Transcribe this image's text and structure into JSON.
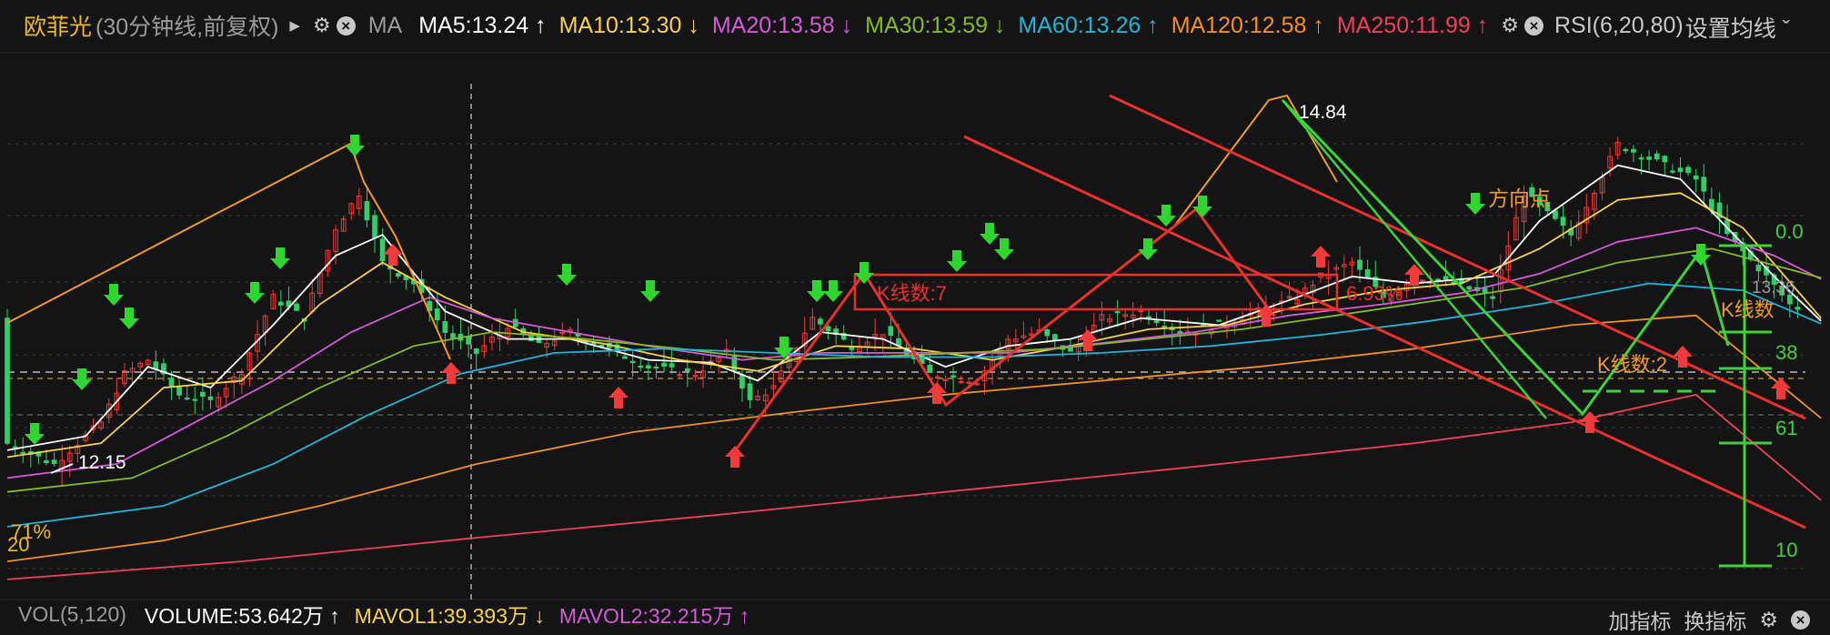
{
  "header": {
    "stock_name": "欧菲光",
    "period": "(30分钟线,前复权)",
    "ma_label": "MA",
    "ma_items": [
      {
        "name": "MA5",
        "value": "13.24",
        "dir": "↑",
        "color": "#ffffff"
      },
      {
        "name": "MA10",
        "value": "13.30",
        "dir": "↓",
        "color": "#f7d24b"
      },
      {
        "name": "MA20",
        "value": "13.58",
        "dir": "↓",
        "color": "#d45ad8"
      },
      {
        "name": "MA30",
        "value": "13.59",
        "dir": "↓",
        "color": "#86b924"
      },
      {
        "name": "MA60",
        "value": "13.26",
        "dir": "↑",
        "color": "#1eb6d6"
      },
      {
        "name": "MA120",
        "value": "12.58",
        "dir": "↑",
        "color": "#f28f25"
      },
      {
        "name": "MA250",
        "value": "11.99",
        "dir": "↑",
        "color": "#f03e5f"
      }
    ],
    "rsi_label": "RSI(6,20,80)",
    "set_ma_label": "设置均线 ˇ"
  },
  "annotations": {
    "high_label": "14.84",
    "low_label": "12.15",
    "direction_point": "方向点",
    "kline_count_1": "K线数:7",
    "kline_count_2": "K线数:2",
    "kline_count_3": "K线数",
    "pct_label": "6.93%",
    "fib_0": "0.0",
    "fib_38": "38",
    "fib_61": "61",
    "fib_100": "10",
    "left_pct": "71%",
    "left_val": "20",
    "right_price": "13.36"
  },
  "volume_bar": {
    "vol_label": "VOL(5,120)",
    "volume_text": "VOLUME:53.642万 ↑",
    "mavol1_text": "MAVOL1:39.393万 ↓",
    "mavol2_text": "MAVOL2:32.215万 ↑",
    "volume_color": "#ffffff",
    "mavol1_color": "#f7d24b",
    "mavol2_color": "#d45ad8",
    "add_indicator": "加指标",
    "switch_indicator": "换指标"
  },
  "chart_data": {
    "type": "line",
    "title": "",
    "x_count": 230,
    "ylim": [
      11.4,
      15.0
    ],
    "price_path": [
      [
        0,
        12.4
      ],
      [
        6,
        12.25
      ],
      [
        12,
        12.55
      ],
      [
        15,
        12.9
      ],
      [
        18,
        13.0
      ],
      [
        22,
        12.75
      ],
      [
        26,
        12.7
      ],
      [
        30,
        12.92
      ],
      [
        34,
        13.45
      ],
      [
        38,
        13.3
      ],
      [
        42,
        13.95
      ],
      [
        45,
        14.2
      ],
      [
        48,
        13.7
      ],
      [
        52,
        13.55
      ],
      [
        56,
        13.2
      ],
      [
        60,
        13.05
      ],
      [
        64,
        13.25
      ],
      [
        68,
        13.1
      ],
      [
        72,
        13.2
      ],
      [
        76,
        13.1
      ],
      [
        82,
        12.95
      ],
      [
        88,
        12.9
      ],
      [
        92,
        13.05
      ],
      [
        95,
        12.7
      ],
      [
        98,
        12.8
      ],
      [
        103,
        13.3
      ],
      [
        108,
        13.1
      ],
      [
        112,
        13.2
      ],
      [
        118,
        12.9
      ],
      [
        124,
        12.85
      ],
      [
        128,
        13.15
      ],
      [
        132,
        13.2
      ],
      [
        136,
        13.05
      ],
      [
        140,
        13.3
      ],
      [
        145,
        13.35
      ],
      [
        150,
        13.2
      ],
      [
        155,
        13.25
      ],
      [
        160,
        13.35
      ],
      [
        165,
        13.45
      ],
      [
        168,
        13.6
      ],
      [
        172,
        13.7
      ],
      [
        176,
        13.45
      ],
      [
        180,
        13.6
      ],
      [
        185,
        13.55
      ],
      [
        190,
        13.45
      ],
      [
        194,
        14.2
      ],
      [
        200,
        13.9
      ],
      [
        206,
        14.55
      ],
      [
        212,
        14.4
      ],
      [
        216,
        14.3
      ],
      [
        220,
        13.9
      ],
      [
        225,
        13.6
      ],
      [
        228,
        13.4
      ],
      [
        232,
        13.3
      ]
    ],
    "ma_series": [
      {
        "name": "MA5",
        "color": "#ffffff",
        "points": [
          [
            0,
            12.35
          ],
          [
            10,
            12.45
          ],
          [
            18,
            12.95
          ],
          [
            26,
            12.8
          ],
          [
            34,
            13.25
          ],
          [
            42,
            13.75
          ],
          [
            48,
            13.9
          ],
          [
            56,
            13.35
          ],
          [
            64,
            13.15
          ],
          [
            72,
            13.15
          ],
          [
            82,
            13.0
          ],
          [
            90,
            12.98
          ],
          [
            96,
            12.85
          ],
          [
            104,
            13.2
          ],
          [
            112,
            13.15
          ],
          [
            120,
            12.95
          ],
          [
            128,
            13.1
          ],
          [
            136,
            13.15
          ],
          [
            145,
            13.3
          ],
          [
            155,
            13.25
          ],
          [
            165,
            13.45
          ],
          [
            172,
            13.6
          ],
          [
            180,
            13.55
          ],
          [
            190,
            13.6
          ],
          [
            196,
            14.0
          ],
          [
            206,
            14.4
          ],
          [
            214,
            14.3
          ],
          [
            220,
            13.95
          ],
          [
            226,
            13.6
          ],
          [
            232,
            13.28
          ]
        ]
      },
      {
        "name": "MA10",
        "color": "#f7d24b",
        "points": [
          [
            0,
            12.3
          ],
          [
            12,
            12.4
          ],
          [
            20,
            12.8
          ],
          [
            30,
            12.85
          ],
          [
            40,
            13.4
          ],
          [
            48,
            13.7
          ],
          [
            56,
            13.45
          ],
          [
            66,
            13.2
          ],
          [
            76,
            13.12
          ],
          [
            86,
            13.0
          ],
          [
            96,
            12.92
          ],
          [
            106,
            13.1
          ],
          [
            116,
            13.08
          ],
          [
            126,
            13.0
          ],
          [
            136,
            13.1
          ],
          [
            146,
            13.22
          ],
          [
            156,
            13.25
          ],
          [
            166,
            13.4
          ],
          [
            176,
            13.5
          ],
          [
            186,
            13.55
          ],
          [
            196,
            13.8
          ],
          [
            206,
            14.15
          ],
          [
            214,
            14.2
          ],
          [
            222,
            13.95
          ],
          [
            232,
            13.3
          ]
        ]
      },
      {
        "name": "MA20",
        "color": "#d45ad8",
        "points": [
          [
            0,
            12.15
          ],
          [
            14,
            12.25
          ],
          [
            24,
            12.55
          ],
          [
            34,
            12.85
          ],
          [
            44,
            13.2
          ],
          [
            54,
            13.45
          ],
          [
            62,
            13.3
          ],
          [
            72,
            13.2
          ],
          [
            82,
            13.1
          ],
          [
            94,
            13.0
          ],
          [
            104,
            13.05
          ],
          [
            116,
            13.05
          ],
          [
            128,
            13.05
          ],
          [
            140,
            13.12
          ],
          [
            152,
            13.2
          ],
          [
            164,
            13.32
          ],
          [
            176,
            13.4
          ],
          [
            186,
            13.48
          ],
          [
            196,
            13.62
          ],
          [
            206,
            13.85
          ],
          [
            216,
            13.95
          ],
          [
            226,
            13.75
          ],
          [
            232,
            13.58
          ]
        ]
      },
      {
        "name": "MA30",
        "color": "#86b924",
        "points": [
          [
            0,
            12.05
          ],
          [
            16,
            12.15
          ],
          [
            28,
            12.45
          ],
          [
            40,
            12.8
          ],
          [
            52,
            13.1
          ],
          [
            62,
            13.2
          ],
          [
            74,
            13.15
          ],
          [
            86,
            13.08
          ],
          [
            98,
            13.0
          ],
          [
            110,
            13.02
          ],
          [
            122,
            13.05
          ],
          [
            134,
            13.08
          ],
          [
            146,
            13.15
          ],
          [
            158,
            13.22
          ],
          [
            170,
            13.32
          ],
          [
            182,
            13.42
          ],
          [
            194,
            13.52
          ],
          [
            206,
            13.7
          ],
          [
            218,
            13.8
          ],
          [
            232,
            13.59
          ]
        ]
      },
      {
        "name": "MA60",
        "color": "#1eb6d6",
        "points": [
          [
            0,
            11.8
          ],
          [
            20,
            11.95
          ],
          [
            34,
            12.25
          ],
          [
            46,
            12.6
          ],
          [
            58,
            12.9
          ],
          [
            70,
            13.05
          ],
          [
            84,
            13.08
          ],
          [
            98,
            13.05
          ],
          [
            112,
            13.02
          ],
          [
            126,
            13.02
          ],
          [
            140,
            13.05
          ],
          [
            154,
            13.1
          ],
          [
            168,
            13.18
          ],
          [
            182,
            13.28
          ],
          [
            196,
            13.4
          ],
          [
            210,
            13.55
          ],
          [
            222,
            13.5
          ],
          [
            232,
            13.26
          ]
        ]
      },
      {
        "name": "MA120",
        "color": "#f28f25",
        "points": [
          [
            0,
            11.55
          ],
          [
            20,
            11.7
          ],
          [
            40,
            11.95
          ],
          [
            60,
            12.25
          ],
          [
            80,
            12.48
          ],
          [
            100,
            12.62
          ],
          [
            120,
            12.75
          ],
          [
            140,
            12.85
          ],
          [
            160,
            12.95
          ],
          [
            180,
            13.08
          ],
          [
            200,
            13.25
          ],
          [
            216,
            13.32
          ],
          [
            232,
            12.58
          ]
        ]
      },
      {
        "name": "MA250",
        "color": "#f03e5f",
        "points": [
          [
            0,
            11.42
          ],
          [
            30,
            11.55
          ],
          [
            60,
            11.72
          ],
          [
            90,
            11.88
          ],
          [
            120,
            12.05
          ],
          [
            150,
            12.22
          ],
          [
            180,
            12.4
          ],
          [
            200,
            12.55
          ],
          [
            216,
            12.75
          ],
          [
            232,
            11.99
          ]
        ]
      }
    ]
  }
}
